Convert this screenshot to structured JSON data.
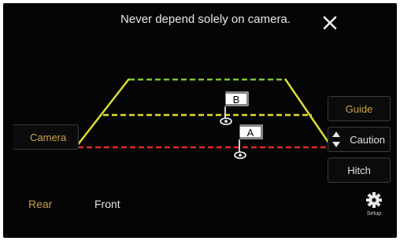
{
  "warning": {
    "text": "Never depend solely on camera."
  },
  "icons": {
    "close": "close-icon",
    "setup": "gear-icon",
    "caution_arrows": "up-down-arrows-icon",
    "flag": "flag-icon"
  },
  "camera_button": {
    "label": "Camera"
  },
  "side_buttons": {
    "guide": "Guide",
    "caution": "Caution",
    "hitch": "Hitch"
  },
  "markers": {
    "a": "A",
    "b": "B"
  },
  "tabs": {
    "rear": "Rear",
    "front": "Front"
  },
  "setup": {
    "label": "Setup"
  },
  "colors": {
    "active_text": "#c9a24a",
    "guide_side": "#d7dc36",
    "guide_green": "#78c83c",
    "guide_yellow": "#e6dc28",
    "guide_red": "#e12828",
    "background": "#050505"
  }
}
